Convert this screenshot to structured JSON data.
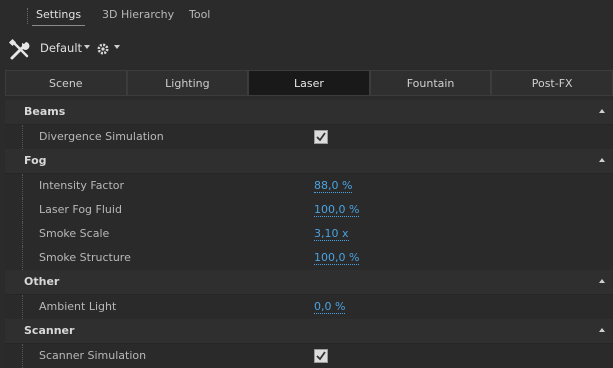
{
  "top_tabs": [
    "Settings",
    "3D Hierarchy",
    "Tool"
  ],
  "toolbar": {
    "preset": "Default"
  },
  "sub_tabs": [
    "Scene",
    "Lighting",
    "Laser",
    "Fountain",
    "Post-FX"
  ],
  "sections": {
    "beams": {
      "title": "Beams",
      "divergence_label": "Divergence Simulation"
    },
    "fog": {
      "title": "Fog",
      "intensity_label": "Intensity Factor",
      "intensity_value": "88,0 %",
      "fluid_label": "Laser Fog Fluid",
      "fluid_value": "100,0 %",
      "scale_label": "Smoke Scale",
      "scale_value": "3,10 x",
      "structure_label": "Smoke Structure",
      "structure_value": "100,0 %"
    },
    "other": {
      "title": "Other",
      "ambient_label": "Ambient Light",
      "ambient_value": "0,0 %"
    },
    "scanner": {
      "title": "Scanner",
      "sim_label": "Scanner Simulation"
    }
  },
  "colors": {
    "accent_value": "#4aa3e0",
    "background": "#2b2b2b"
  }
}
